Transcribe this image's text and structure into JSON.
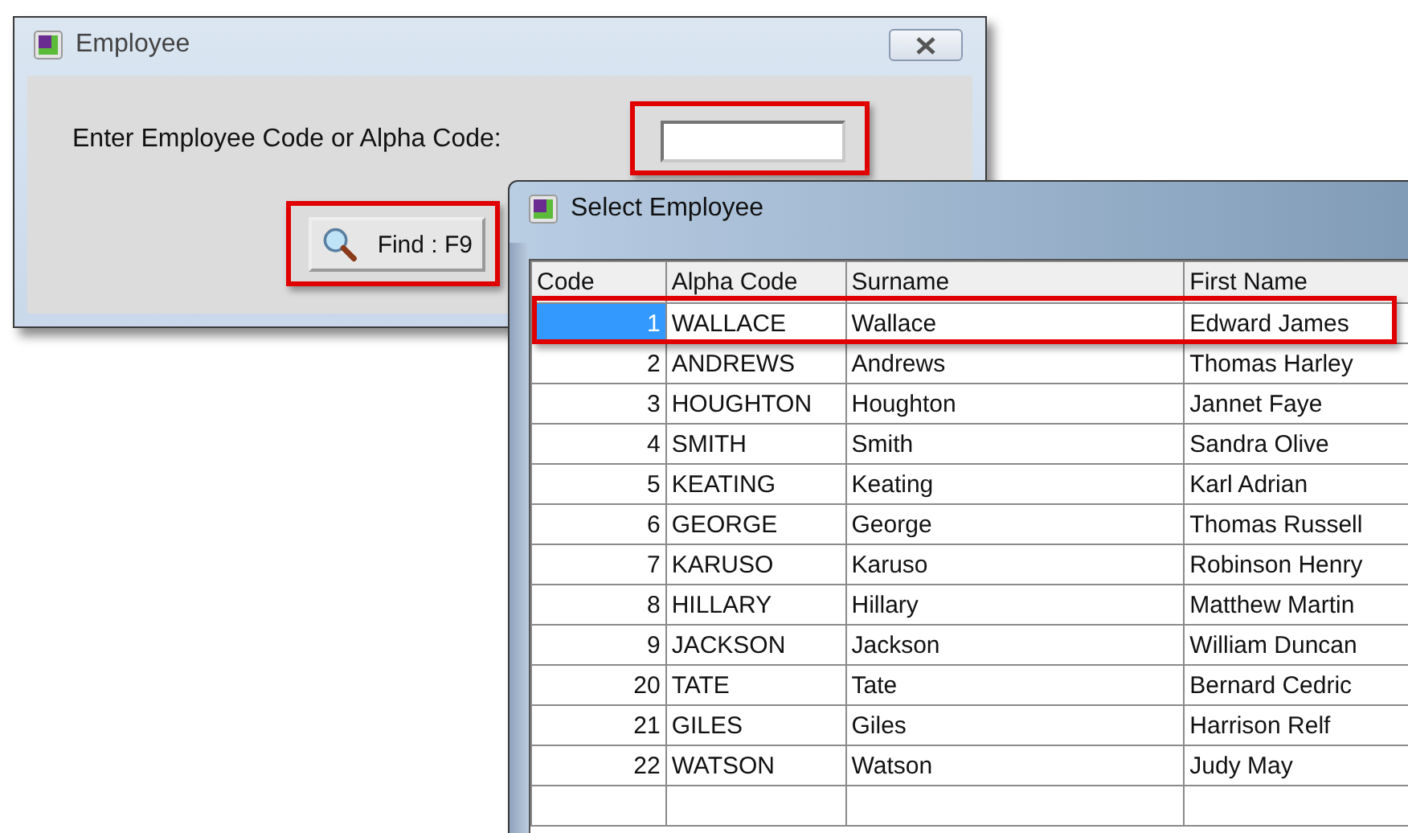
{
  "employee_window": {
    "title": "Employee",
    "prompt": "Enter Employee Code or Alpha Code:",
    "find_button": {
      "label": "Find : F9"
    }
  },
  "select_window": {
    "title": "Select Employee",
    "table": {
      "columns": [
        "Code",
        "Alpha Code",
        "Surname",
        "First Name"
      ],
      "rows": [
        {
          "code": "1",
          "alpha_code": "WALLACE",
          "surname": "Wallace",
          "first_name": "Edward James",
          "selected": true
        },
        {
          "code": "2",
          "alpha_code": "ANDREWS",
          "surname": "Andrews",
          "first_name": "Thomas Harley",
          "selected": false
        },
        {
          "code": "3",
          "alpha_code": "HOUGHTON",
          "surname": "Houghton",
          "first_name": "Jannet Faye",
          "selected": false
        },
        {
          "code": "4",
          "alpha_code": "SMITH",
          "surname": "Smith",
          "first_name": "Sandra Olive",
          "selected": false
        },
        {
          "code": "5",
          "alpha_code": "KEATING",
          "surname": "Keating",
          "first_name": "Karl Adrian",
          "selected": false
        },
        {
          "code": "6",
          "alpha_code": "GEORGE",
          "surname": "George",
          "first_name": "Thomas Russell",
          "selected": false
        },
        {
          "code": "7",
          "alpha_code": "KARUSO",
          "surname": "Karuso",
          "first_name": "Robinson Henry",
          "selected": false
        },
        {
          "code": "8",
          "alpha_code": "HILLARY",
          "surname": "Hillary",
          "first_name": "Matthew Martin",
          "selected": false
        },
        {
          "code": "9",
          "alpha_code": "JACKSON",
          "surname": "Jackson",
          "first_name": "William Duncan",
          "selected": false
        },
        {
          "code": "20",
          "alpha_code": "TATE",
          "surname": "Tate",
          "first_name": "Bernard Cedric",
          "selected": false
        },
        {
          "code": "21",
          "alpha_code": "GILES",
          "surname": "Giles",
          "first_name": "Harrison Relf",
          "selected": false
        },
        {
          "code": "22",
          "alpha_code": "WATSON",
          "surname": "Watson",
          "first_name": "Judy May",
          "selected": false
        }
      ]
    }
  }
}
